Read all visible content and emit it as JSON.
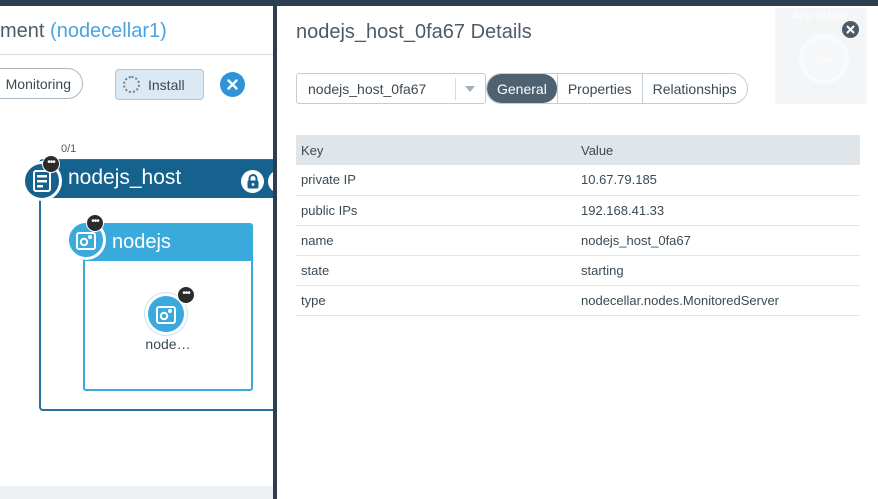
{
  "blueprint": {
    "title_prefix": "ment",
    "deployment_name": "(nodecellar1)",
    "buttons": {
      "monitoring_label": "Monitoring",
      "install_label": "Install"
    },
    "host_node": {
      "name": "nodejs_host",
      "instance_count": "0/1"
    },
    "nodejs_node": {
      "name": "nodejs"
    },
    "inner_node": {
      "name": "node…"
    }
  },
  "details": {
    "title": "nodejs_host_0fa67 Details",
    "app_status": {
      "label": "App Status",
      "percent": "0%"
    },
    "selected_instance": "nodejs_host_0fa67",
    "tabs": [
      {
        "label": "General",
        "active": true
      },
      {
        "label": "Properties",
        "active": false
      },
      {
        "label": "Relationships",
        "active": false
      }
    ],
    "table": {
      "headers": {
        "key": "Key",
        "value": "Value"
      },
      "rows": [
        {
          "key": "private IP",
          "value": "10.67.79.185"
        },
        {
          "key": "public IPs",
          "value": "192.168.41.33"
        },
        {
          "key": "name",
          "value": "nodejs_host_0fa67"
        },
        {
          "key": "state",
          "value": "starting"
        },
        {
          "key": "type",
          "value": "nodecellar.nodes.MonitoredServer"
        }
      ]
    }
  },
  "colors": {
    "frame": "#2d3e50",
    "host_blue": "#16628f",
    "node_blue": "#3aa9db",
    "accent_blue": "#2f93d8",
    "active_tab": "#4f6272"
  },
  "icons": {
    "cancel": "close-icon",
    "install": "spinner-icon",
    "host": "server-icon",
    "node": "gears-icon",
    "lock": "lock-icon",
    "more": "more-options-icon",
    "close_details": "close-icon",
    "dropdown": "chevron-down-icon"
  }
}
